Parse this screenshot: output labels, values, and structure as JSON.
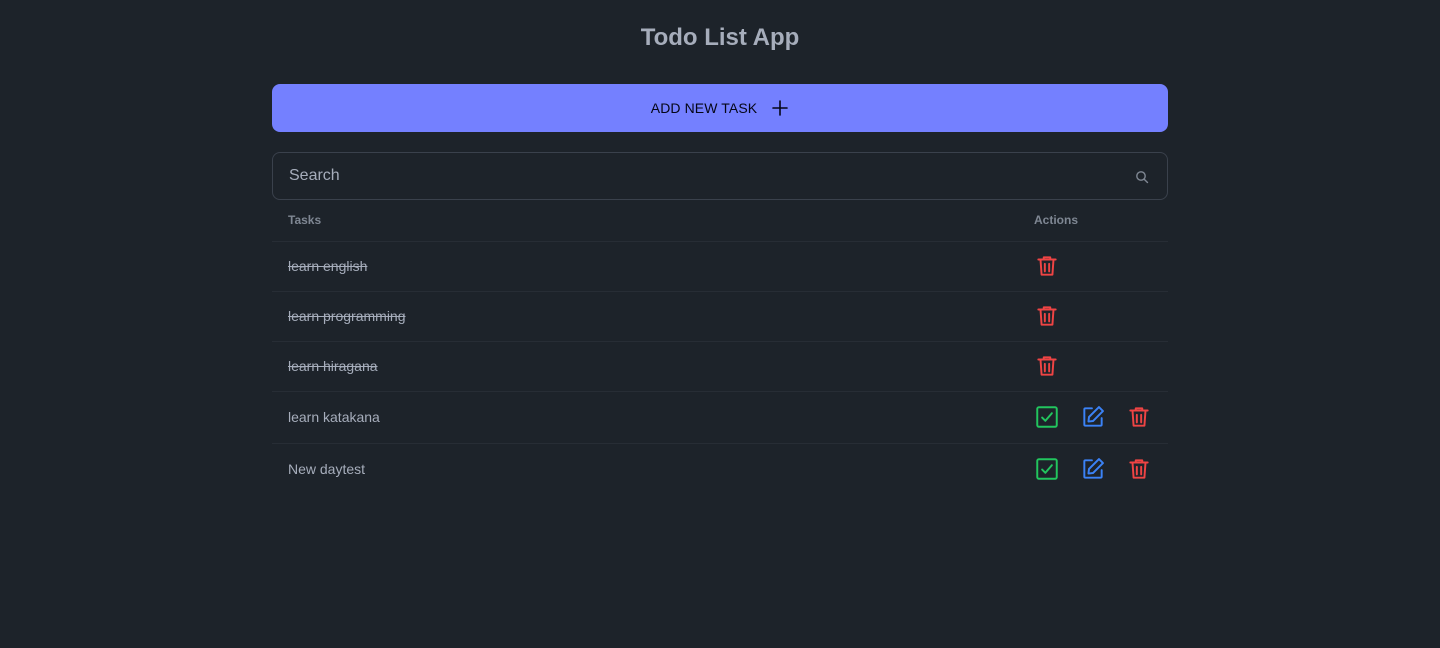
{
  "app": {
    "title": "Todo List App"
  },
  "toolbar": {
    "add_label": "ADD NEW TASK",
    "add_icon": "plus-icon"
  },
  "search": {
    "placeholder": "Search",
    "value": "",
    "icon": "search-icon"
  },
  "table": {
    "columns": [
      "Tasks",
      "Actions"
    ],
    "rows": [
      {
        "task": "learn english",
        "completed": true
      },
      {
        "task": "learn programming",
        "completed": true
      },
      {
        "task": "learn hiragana",
        "completed": true
      },
      {
        "task": "learn katakana",
        "completed": false
      },
      {
        "task": "New daytest",
        "completed": false
      }
    ]
  },
  "colors": {
    "background": "#1d232a",
    "primary": "#7480ff",
    "text": "#a6adbb",
    "complete": "#22c55e",
    "edit": "#3b82f6",
    "delete": "#ef4444"
  }
}
